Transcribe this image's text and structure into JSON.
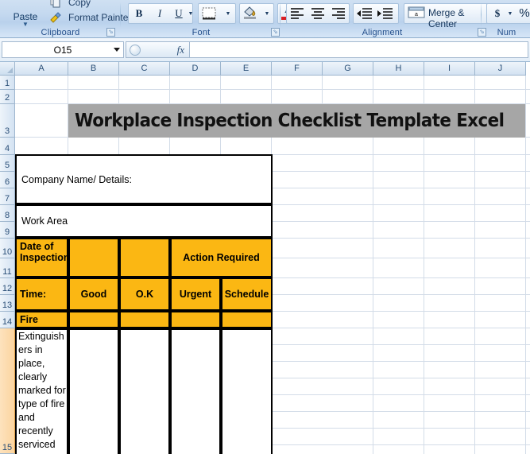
{
  "ribbon": {
    "groups": [
      {
        "name": "Clipboard",
        "label": "Clipboard"
      },
      {
        "name": "Font",
        "label": "Font"
      },
      {
        "name": "Alignment",
        "label": "Alignment"
      },
      {
        "name": "Number",
        "label": "Num"
      }
    ],
    "clipboard": {
      "paste_label": "Paste",
      "copy_label": "Copy",
      "format_painter_label": "Format Painter"
    },
    "font_buttons": [
      {
        "name": "bold-button",
        "label": "B"
      },
      {
        "name": "italic-button",
        "label": "I"
      },
      {
        "name": "underline-button",
        "label": "U"
      },
      {
        "name": "borders-button",
        "label": ""
      },
      {
        "name": "fill-color-button",
        "label": ""
      },
      {
        "name": "font-color-button",
        "label": "A"
      }
    ],
    "alignment_buttons": [
      {
        "name": "align-left-button"
      },
      {
        "name": "align-center-button"
      },
      {
        "name": "align-right-button"
      },
      {
        "name": "decrease-indent-button"
      },
      {
        "name": "increase-indent-button"
      }
    ],
    "merge_center_label": "Merge & Center",
    "number_buttons": [
      {
        "name": "currency-button",
        "label": "$"
      },
      {
        "name": "percent-button",
        "label": "%"
      }
    ]
  },
  "formula_bar": {
    "name_box_value": "O15",
    "formula_value": "",
    "fx_label": "fx"
  },
  "grid": {
    "columns": [
      "A",
      "B",
      "C",
      "D",
      "E",
      "F",
      "G",
      "H",
      "I",
      "J"
    ],
    "rows": [
      "1",
      "2",
      "3",
      "4",
      "5",
      "6",
      "7",
      "8",
      "9",
      "10",
      "11",
      "12",
      "13",
      "14",
      "15"
    ],
    "selected_row": "15"
  },
  "sheet": {
    "title": "Workplace Inspection Checklist Template Excel",
    "title_bg": "#a6a6a6",
    "header_bg": "#FBB713",
    "company_label": "Company Name/ Details:",
    "work_area_label": "Work Area",
    "date_of_inspection_label": "Date of Inspection:",
    "action_required_label": "Action Required",
    "time_label": "Time:",
    "good_label": "Good",
    "ok_label": "O.K",
    "urgent_label": "Urgent",
    "schedule_label": "Schedule",
    "fire_label": "Fire",
    "extinguisher_text": "Extinguishers in place, clearly marked for type of fire and recently serviced"
  }
}
